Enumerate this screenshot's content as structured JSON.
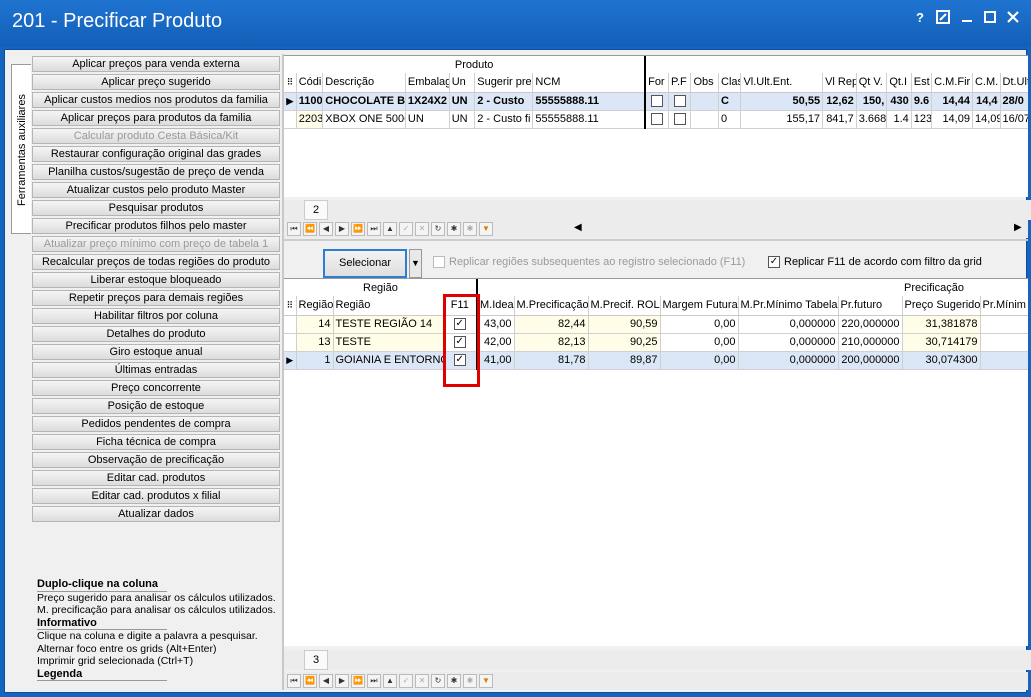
{
  "window": {
    "title": "201 - Precificar Produto",
    "help": "?"
  },
  "side_tab": "Ferramentas auxiliares",
  "tools": [
    {
      "label": "Aplicar preços para venda externa",
      "enabled": true
    },
    {
      "label": "Aplicar preço sugerido",
      "enabled": true
    },
    {
      "label": "Aplicar custos medios nos produtos da familia",
      "enabled": true
    },
    {
      "label": "Aplicar preços para produtos da familia",
      "enabled": true
    },
    {
      "label": "Calcular produto Cesta Básica/Kit",
      "enabled": false
    },
    {
      "label": "Restaurar configuração original das grades",
      "enabled": true
    },
    {
      "label": "Planilha custos/sugestão de preço de venda",
      "enabled": true
    },
    {
      "label": "Atualizar custos pelo produto Master",
      "enabled": true
    },
    {
      "label": "Pesquisar produtos",
      "enabled": true
    },
    {
      "label": "Precificar produtos filhos pelo master",
      "enabled": true
    },
    {
      "label": "Atualizar preço mínimo com preço de tabela 1",
      "enabled": false
    },
    {
      "label": "Recalcular preços de todas regiões do produto",
      "enabled": true
    },
    {
      "label": "Liberar estoque bloqueado",
      "enabled": true
    },
    {
      "label": "Repetir preços para demais regiões",
      "enabled": true
    },
    {
      "label": "Habilitar filtros por coluna",
      "enabled": true
    },
    {
      "label": "Detalhes do produto",
      "enabled": true
    },
    {
      "label": "Giro estoque anual",
      "enabled": true
    },
    {
      "label": "Últimas entradas",
      "enabled": true
    },
    {
      "label": "Preço concorrente",
      "enabled": true
    },
    {
      "label": "Posição de estoque",
      "enabled": true
    },
    {
      "label": "Pedidos pendentes de compra",
      "enabled": true
    },
    {
      "label": "Ficha técnica de compra",
      "enabled": true
    },
    {
      "label": "Observação de precificação",
      "enabled": true
    },
    {
      "label": "Editar cad. produtos",
      "enabled": true
    },
    {
      "label": "Editar cad. produtos x filial",
      "enabled": true
    },
    {
      "label": "Atualizar dados",
      "enabled": true
    }
  ],
  "info": {
    "h1": "Duplo-clique na coluna",
    "l1": "Preço sugerido para analisar os cálculos utilizados.",
    "l2": "M. precificação para analisar os cálculos utilizados.",
    "h2": "Informativo",
    "l3": "Clique na coluna e digite a palavra a pesquisar.",
    "l4": "Alternar foco entre os grids (Alt+Enter)",
    "l5": "Imprimir grid selecionada (Ctrl+T)",
    "h3": "Legenda"
  },
  "product_grid": {
    "band": "Produto",
    "headers": [
      "Códi",
      "Descrição",
      "Embalag",
      "Un",
      "Sugerir pre",
      "NCM",
      "For",
      "P.F",
      "Obs",
      "Clas",
      "Vl.Ult.Ent.",
      "Vl Rep",
      "Qt V.",
      "Qt.I",
      "Est",
      "C.M.Fir",
      "C.M.",
      "Dt.Ult"
    ],
    "rows": [
      [
        "1100",
        "CHOCOLATE B",
        "1X24X2",
        "UN",
        "2 - Custo",
        "55555888.11",
        "",
        "",
        "",
        "C",
        "50,55",
        "12,62",
        "150,",
        "430",
        "9.6",
        "14,44",
        "14,4",
        "28/0"
      ],
      [
        "2203",
        "XBOX ONE 500G",
        "UN",
        "UN",
        "2 - Custo fi",
        "55555888.11",
        "",
        "",
        "",
        "0",
        "155,17",
        "841,7",
        "3.668",
        "1.4",
        "123",
        "14,09",
        "14,09",
        "16/07"
      ]
    ],
    "count": "2"
  },
  "actions": {
    "select_label": "Selecionar",
    "replicate_label": "Replicar regiões subsequentes ao registro selecionado (F11)",
    "replicate_filter_label": "Replicar F11 de acordo com filtro da grid"
  },
  "region_grid": {
    "band_region": "Região",
    "band_pricing": "Precificação",
    "headers": [
      "Região",
      "Região",
      "F11",
      "M.Ideal",
      "M.Precificação",
      "M.Precif. ROL",
      "Margem Futura",
      "M.Pr.Mínimo Tabela",
      "Pr.futuro",
      "Preço Sugerido",
      "Pr.Mínim"
    ],
    "rows": [
      [
        "14",
        "TESTE REGIÃO 14",
        "✓",
        "43,00",
        "82,44",
        "90,59",
        "0,00",
        "0,000000",
        "220,000000",
        "31,381878",
        ""
      ],
      [
        "13",
        "TESTE",
        "✓",
        "42,00",
        "82,13",
        "90,25",
        "0,00",
        "0,000000",
        "210,000000",
        "30,714179",
        ""
      ],
      [
        "1",
        "GOIANIA E ENTORNOS",
        "✓",
        "41,00",
        "81,78",
        "89,87",
        "0,00",
        "0,000000",
        "200,000000",
        "30,074300",
        ""
      ]
    ],
    "count": "3"
  }
}
